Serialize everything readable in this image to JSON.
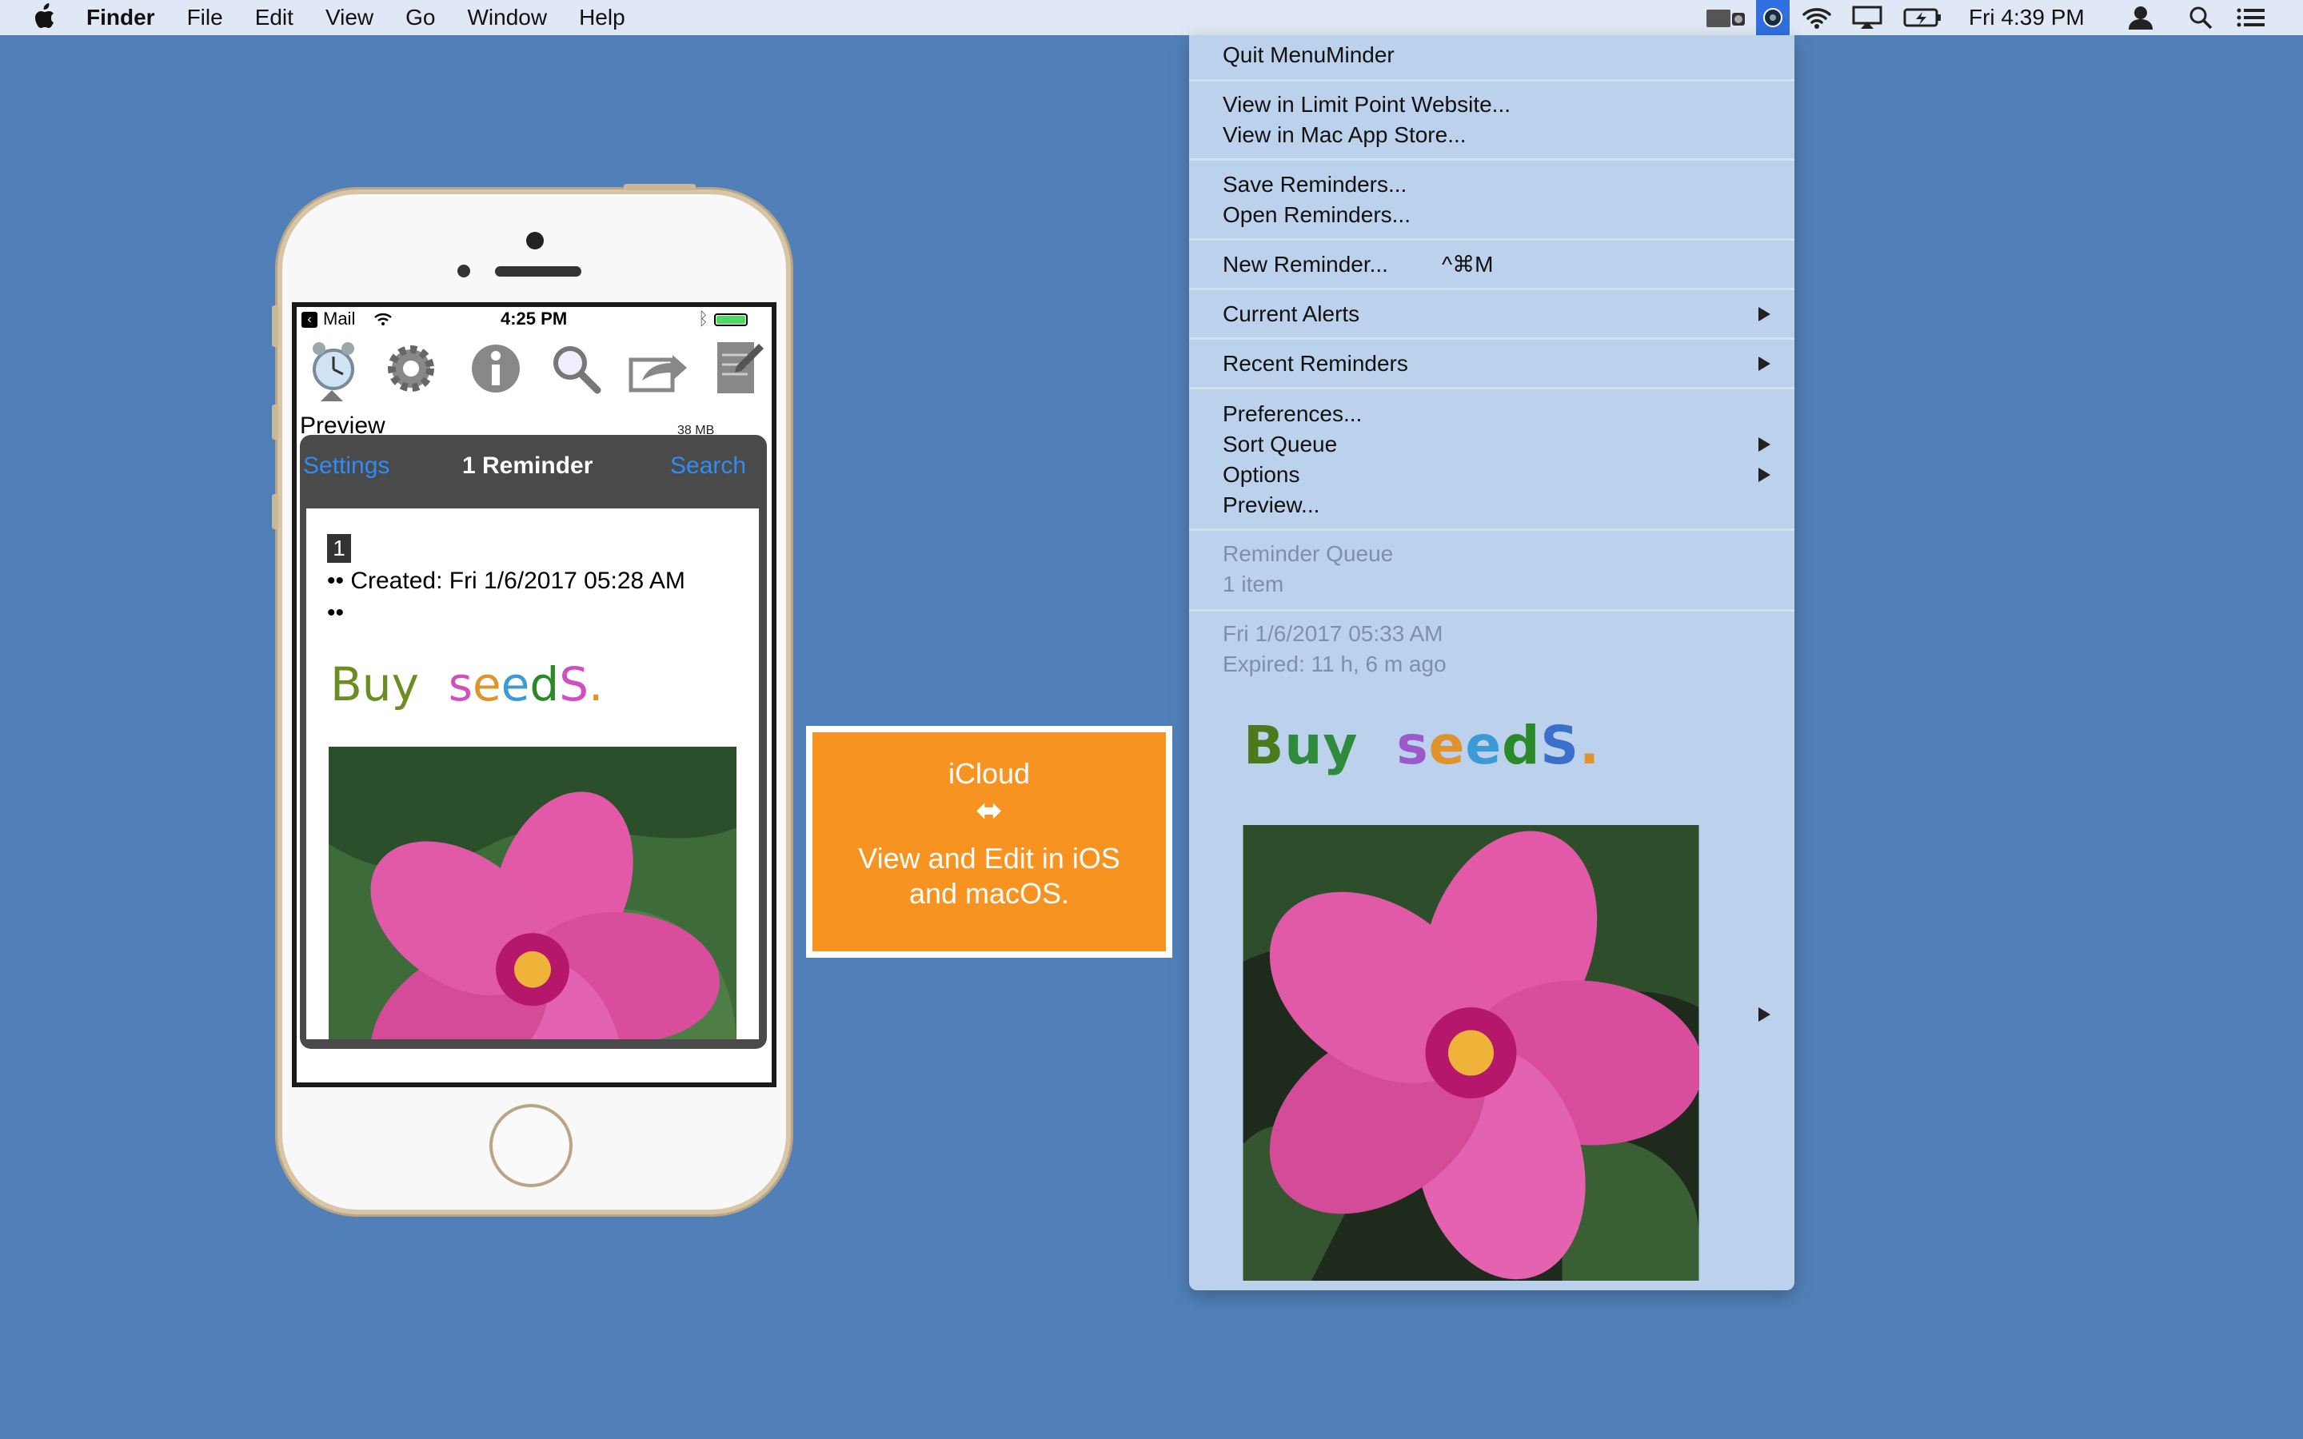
{
  "menubar": {
    "app": "Finder",
    "menus": [
      "File",
      "Edit",
      "View",
      "Go",
      "Window",
      "Help"
    ],
    "clock": "Fri 4:39 PM"
  },
  "menu": {
    "quit": "Quit MenuMinder",
    "view_website": "View in Limit Point Website...",
    "view_store": "View in Mac App Store...",
    "save": "Save Reminders...",
    "open": "Open Reminders...",
    "new": "New Reminder...",
    "new_shortcut": "^⌘M",
    "current_alerts": "Current Alerts",
    "recent": "Recent Reminders",
    "preferences": "Preferences...",
    "sort_queue": "Sort Queue",
    "options": "Options",
    "preview": "Preview...",
    "queue_title": "Reminder Queue",
    "queue_count": "1 item",
    "reminder_date": "Fri 1/6/2017 05:33 AM",
    "reminder_expired": "Expired: 11 h, 6 m ago",
    "reminder_title_letters": [
      "B",
      "u",
      "y",
      " ",
      "s",
      "e",
      "e",
      "d",
      "S",
      "."
    ],
    "reminder_title_colors": [
      "#4a7a1c",
      "#2e8b3c",
      "#2e8b3c",
      "#000",
      "#9b59c9",
      "#e0932b",
      "#3c9bd6",
      "#2a8a2a",
      "#3a6fcb",
      "#e0932b"
    ]
  },
  "callout": {
    "title": "iCloud",
    "arrow": "⬌",
    "line1": "View and Edit in iOS",
    "line2": "and macOS."
  },
  "phone": {
    "status": {
      "carrier": "Mail",
      "time": "4:25 PM"
    },
    "section": "Preview",
    "storage": "38 MB",
    "nav": {
      "left": "Settings",
      "title": "1 Reminder",
      "right": "Search"
    },
    "badge": "1",
    "created": "•• Created: Fri 1/6/2017 05:28 AM",
    "dots": "••",
    "title_letters": [
      "B",
      "u",
      "y",
      " ",
      "s",
      "e",
      "e",
      "d",
      "S",
      "."
    ],
    "title_colors": [
      "#6b8e23",
      "#6b8e23",
      "#6b8e23",
      "#000",
      "#d04fbf",
      "#e0932b",
      "#3c9bd6",
      "#2a8a2a",
      "#d04fbf",
      "#e0932b"
    ]
  },
  "colors": {
    "desktop": "#5180b8",
    "menu": "#bcd1ec",
    "callout": "#f79421",
    "ios_link": "#2f8cf5"
  }
}
